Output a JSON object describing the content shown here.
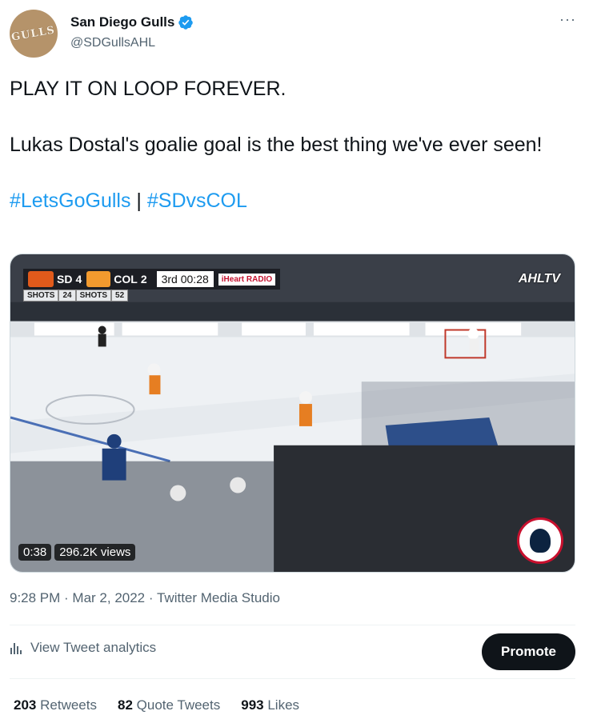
{
  "author": {
    "avatar_text": "GULLS",
    "display_name": "San Diego Gulls",
    "handle": "@SDGullsAHL",
    "verified_icon": "verified-badge-icon",
    "more_label": "···"
  },
  "tweet": {
    "line1": "PLAY IT ON LOOP FOREVER.",
    "line2": "Lukas Dostal's goalie goal is the best thing we've ever seen!",
    "hashtag1": "#LetsGoGulls",
    "separator": " | ",
    "hashtag2": "#SDvsCOL"
  },
  "video": {
    "home_team": "SD",
    "home_score": "4",
    "away_team": "COL",
    "away_score": "2",
    "period_clock": "3rd 00:28",
    "radio_label": "iHeart RADIO",
    "shots_label_home": "SHOTS",
    "shots_home": "24",
    "shots_label_away": "SHOTS",
    "shots_away": "52",
    "broadcaster": "AHLTV",
    "duration": "0:38",
    "views": "296.2K views"
  },
  "meta": {
    "time": "9:28 PM",
    "dot": " · ",
    "date": "Mar 2, 2022",
    "source": "Twitter Media Studio"
  },
  "actions": {
    "analytics_label": "View Tweet analytics",
    "promote_label": "Promote"
  },
  "stats": {
    "retweets_count": "203",
    "retweets_label": "Retweets",
    "quotes_count": "82",
    "quotes_label": "Quote Tweets",
    "likes_count": "993",
    "likes_label": "Likes"
  },
  "colors": {
    "link": "#1d9bf0",
    "text": "#0f1419",
    "secondary": "#536471",
    "promote_bg": "#0f1419"
  }
}
